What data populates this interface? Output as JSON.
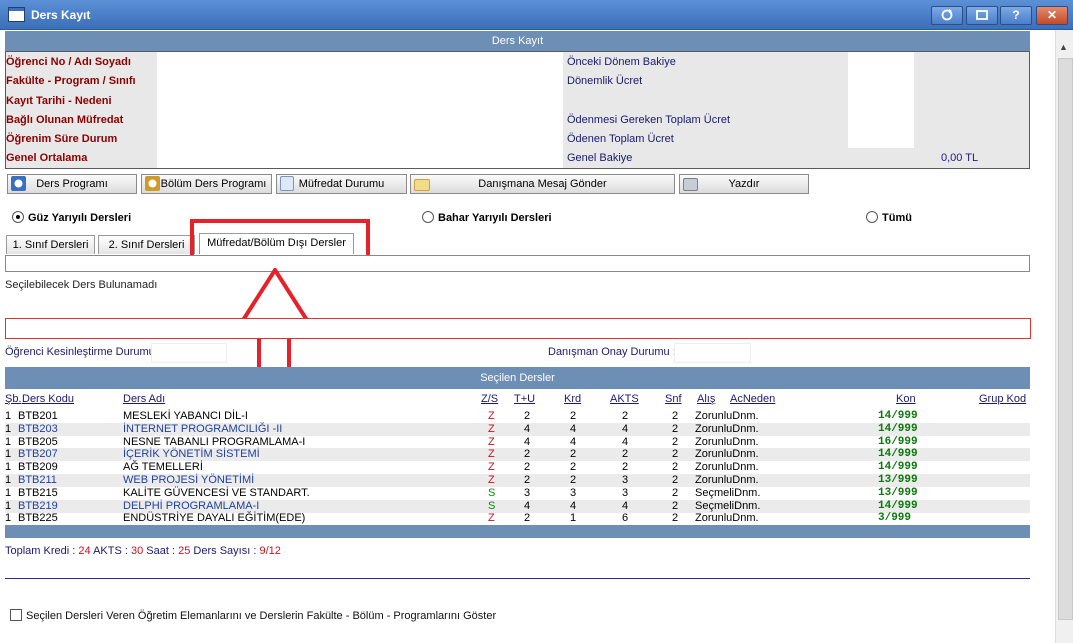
{
  "window": {
    "title": "Ders Kayıt",
    "buttons": [
      "refresh",
      "restore",
      "help",
      "close"
    ],
    "help_label": "?",
    "close_label": "✕"
  },
  "header": {
    "title": "Ders Kayıt"
  },
  "info": {
    "left_labels": [
      "Öğrenci No / Adı Soyadı",
      "Fakülte - Program / Sınıfı",
      "Kayıt Tarihi - Nedeni",
      "Bağlı Olunan Müfredat",
      "Öğrenim Süre Durum",
      "Genel Ortalama"
    ],
    "right_labels": [
      "Önceki Dönem Bakiye",
      "Dönemlik Ücret",
      "",
      "Ödenmesi Gereken Toplam Ücret",
      "Ödenen Toplam Ücret",
      "Genel Bakiye"
    ],
    "genel_bakiye_value": "0,00 TL"
  },
  "toolbar": {
    "ders_programi": "Ders Programı",
    "bolum_ders_programi": "Bölüm Ders Programı",
    "mufredat_durumu": "Müfredat Durumu",
    "danismana_mesaj": "Danışmana Mesaj Gönder",
    "yazdir": "Yazdır"
  },
  "semester": {
    "guz": "Güz Yarıyılı Dersleri",
    "bahar": "Bahar Yarıyılı Dersleri",
    "tumu": "Tümü",
    "selected": "guz"
  },
  "tabs": [
    {
      "label": "1. Sınıf Dersleri"
    },
    {
      "label": "2. Sınıf Dersleri"
    },
    {
      "label": "Müfredat/Bölüm Dışı Dersler",
      "active": true
    }
  ],
  "no_results": "Seçilebilecek Ders Bulunamadı",
  "status": {
    "kesinlestirme_label": "Öğrenci Kesinleştirme Durumu",
    "danisman_label": "Danışman Onay Durumu :"
  },
  "selected_courses": {
    "title": "Seçilen Dersler",
    "headers": {
      "sb": "Şb.",
      "kod": "Ders Kodu",
      "ad": "Ders Adı",
      "zs": "Z/S",
      "tu": "T+U",
      "krd": "Krd",
      "akts": "AKTS",
      "snf": "Snf",
      "alis": "Alış",
      "acneden": "AcNeden",
      "kon": "Kon",
      "grup": "Grup Kod"
    },
    "rows": [
      {
        "sb": "1",
        "kod": "BTB201",
        "ad": "MESLEKİ YABANCI DİL-I",
        "zs": "Z",
        "tu": "2",
        "krd": "2",
        "akts": "2",
        "snf": "2",
        "alis": "ZorunluDnm.",
        "kon": "14/999",
        "color": "black"
      },
      {
        "sb": "1",
        "kod": "BTB203",
        "ad": "İNTERNET PROGRAMCILIĞI -II",
        "zs": "Z",
        "tu": "4",
        "krd": "4",
        "akts": "4",
        "snf": "2",
        "alis": "ZorunluDnm.",
        "kon": "14/999",
        "color": "blue"
      },
      {
        "sb": "1",
        "kod": "BTB205",
        "ad": "NESNE TABANLI PROGRAMLAMA-I",
        "zs": "Z",
        "tu": "4",
        "krd": "4",
        "akts": "4",
        "snf": "2",
        "alis": "ZorunluDnm.",
        "kon": "16/999",
        "color": "black"
      },
      {
        "sb": "1",
        "kod": "BTB207",
        "ad": "İÇERİK YÖNETİM SİSTEMİ",
        "zs": "Z",
        "tu": "2",
        "krd": "2",
        "akts": "2",
        "snf": "2",
        "alis": "ZorunluDnm.",
        "kon": "14/999",
        "color": "blue"
      },
      {
        "sb": "1",
        "kod": "BTB209",
        "ad": "AĞ TEMELLERİ",
        "zs": "Z",
        "tu": "2",
        "krd": "2",
        "akts": "2",
        "snf": "2",
        "alis": "ZorunluDnm.",
        "kon": "14/999",
        "color": "black"
      },
      {
        "sb": "1",
        "kod": "BTB211",
        "ad": "WEB PROJESİ YÖNETİMİ",
        "zs": "Z",
        "tu": "2",
        "krd": "2",
        "akts": "3",
        "snf": "2",
        "alis": "ZorunluDnm.",
        "kon": "13/999",
        "color": "blue"
      },
      {
        "sb": "1",
        "kod": "BTB215",
        "ad": "KALİTE GÜVENCESİ VE STANDART.",
        "zs": "S",
        "tu": "3",
        "krd": "3",
        "akts": "3",
        "snf": "2",
        "alis": "SeçmeliDnm.",
        "kon": "13/999",
        "color": "black"
      },
      {
        "sb": "1",
        "kod": "BTB219",
        "ad": "DELPHİ PROGRAMLAMA-I",
        "zs": "S",
        "tu": "4",
        "krd": "4",
        "akts": "4",
        "snf": "2",
        "alis": "SeçmeliDnm.",
        "kon": "14/999",
        "color": "blue"
      },
      {
        "sb": "1",
        "kod": "BTB225",
        "ad": "ENDÜSTRİYE DAYALI EĞİTİM(EDE)",
        "zs": "Z",
        "tu": "2",
        "krd": "1",
        "akts": "6",
        "snf": "2",
        "alis": "ZorunluDnm.",
        "kon": "3/999",
        "color": "black"
      }
    ]
  },
  "totals": {
    "kredi_label": "Toplam Kredi :",
    "kredi": "24",
    "akts_label": "AKTS :",
    "akts": "30",
    "saat_label": "Saat :",
    "saat": "25",
    "ders_label": "Ders Sayısı :",
    "ders": "9/12"
  },
  "show_instructors_label": "Seçilen Dersleri Veren Öğretim Elemanlarını ve Derslerin Fakülte - Bölüm - Programlarını Göster",
  "colors": {
    "header_bar": "#6d8eb5",
    "accent_red": "#e8202a",
    "label_red": "#8b0000",
    "text_blue": "#1a1a6e"
  }
}
